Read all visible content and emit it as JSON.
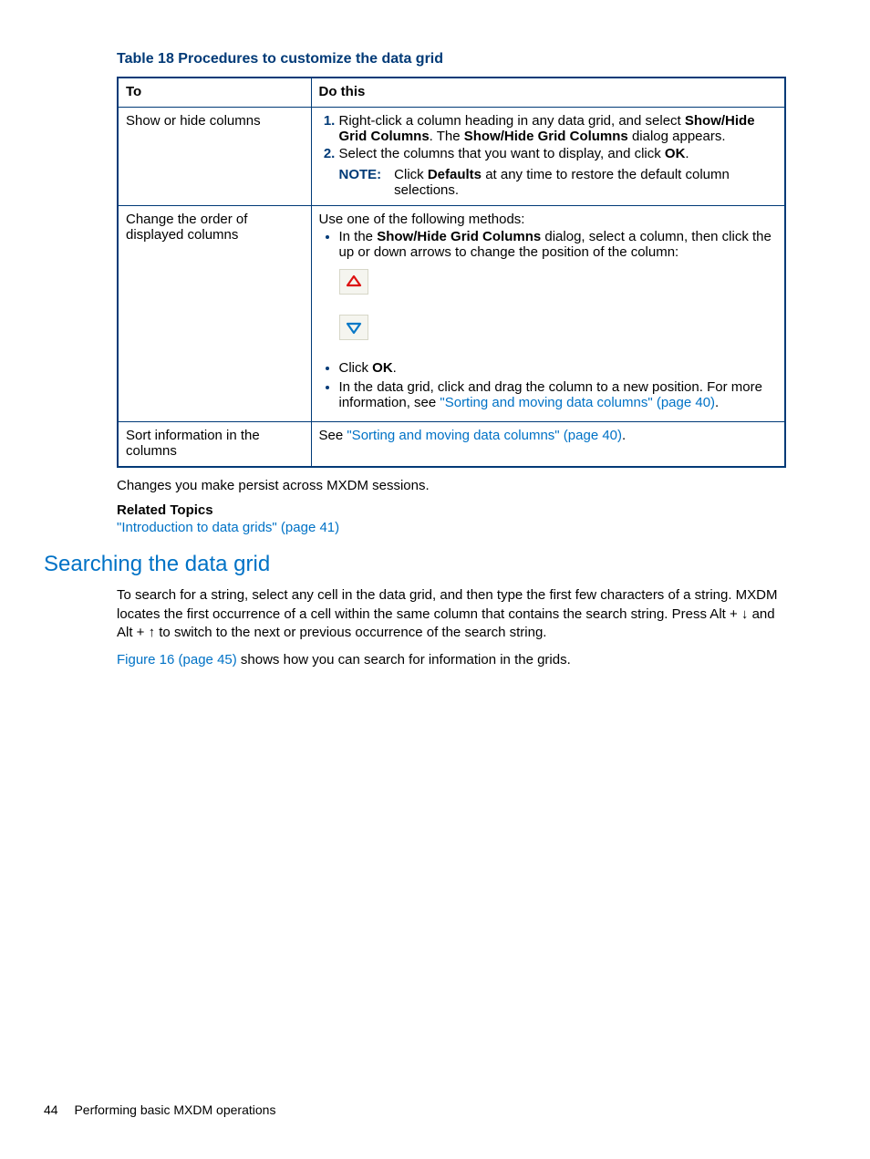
{
  "table": {
    "caption": "Table 18 Procedures to customize the data grid",
    "headers": {
      "to": "To",
      "do": "Do this"
    },
    "rows": {
      "r1": {
        "to": "Show or hide columns",
        "step1_a": "Right-click a column heading in any data grid, and select ",
        "step1_b": "Show/Hide Grid Columns",
        "step1_c": ". The ",
        "step1_d": "Show/Hide Grid Columns",
        "step1_e": " dialog appears.",
        "step2_a": "Select the columns that you want to display, and click ",
        "step2_b": "OK",
        "step2_c": ".",
        "note_label": "NOTE:",
        "note_a": "Click ",
        "note_b": "Defaults",
        "note_c": " at any time to restore the default column selections."
      },
      "r2": {
        "to": "Change the order of displayed columns",
        "intro": "Use one of the following methods:",
        "b1_a": "In the ",
        "b1_b": "Show/Hide Grid Columns",
        "b1_c": " dialog, select a column, then click the up or down arrows to change the position of the column:",
        "b2_a": "Click ",
        "b2_b": "OK",
        "b2_c": ".",
        "b3_a": "In the data grid, click and drag the column to a new position. For more information, see ",
        "b3_link": "\"Sorting and moving data columns\" (page 40)",
        "b3_c": "."
      },
      "r3": {
        "to": "Sort information in the columns",
        "a": "See ",
        "link": "\"Sorting and moving data columns\" (page 40)",
        "c": "."
      }
    }
  },
  "body": {
    "persist": "Changes you make persist across MXDM sessions.",
    "related_h": "Related Topics",
    "related_link": "\"Introduction to data grids\" (page 41)"
  },
  "section": {
    "heading": "Searching the data grid",
    "para1": "To search for a string, select any cell in the data grid, and then type the first few characters of a string. MXDM locates the first occurrence of a cell within the same column that contains the search string. Press Alt + ↓ and Alt + ↑ to switch to the next or previous occurrence of the search string.",
    "para2_link": "Figure 16 (page 45)",
    "para2_rest": " shows how you can search for information in the grids."
  },
  "footer": {
    "page_num": "44",
    "chapter": "Performing basic MXDM operations"
  }
}
